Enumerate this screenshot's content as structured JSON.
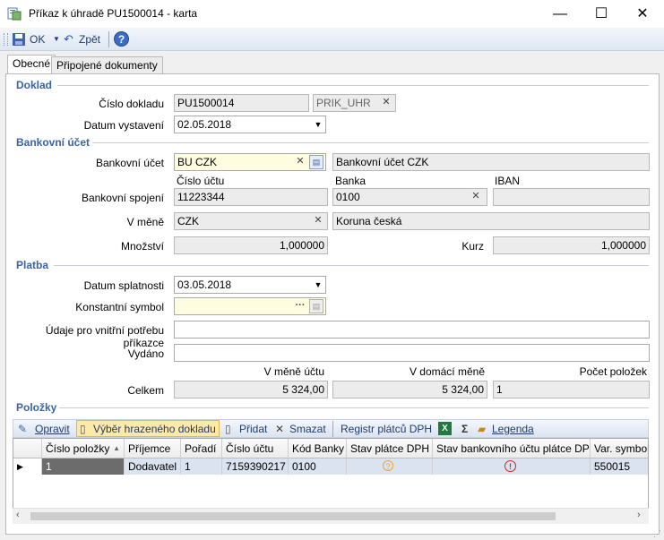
{
  "window": {
    "title": "Příkaz k úhradě PU1500014 - karta",
    "minimize": "—",
    "maximize": "☐",
    "close": "✕"
  },
  "toolbar": {
    "ok_label": "OK",
    "back_label": "Zpět",
    "help_label": "?"
  },
  "tabs": [
    {
      "label": "Obecné",
      "active": true
    },
    {
      "label": "Připojené dokumenty",
      "active": false
    }
  ],
  "doklad": {
    "section_title": "Doklad",
    "cislo_label": "Číslo dokladu",
    "cislo_value": "PU1500014",
    "rada_value": "PRIK_UHR",
    "datum_label": "Datum vystavení",
    "datum_value": "02.05.2018"
  },
  "bankovni_ucet": {
    "section_title": "Bankovní účet",
    "ucet_label": "Bankovní účet",
    "ucet_value": "BU CZK",
    "ucet_name": "Bankovní účet CZK",
    "col_cislo_uctu": "Číslo účtu",
    "col_banka": "Banka",
    "col_iban": "IBAN",
    "spojeni_label": "Bankovní spojení",
    "cislo_uctu_value": "11223344",
    "banka_value": "0100",
    "iban_value": "",
    "mena_label": "V měně",
    "mena_value": "CZK",
    "mena_name": "Koruna česká",
    "mnozstvi_label": "Množství",
    "mnozstvi_value": "1,000000",
    "kurz_label": "Kurz",
    "kurz_value": "1,000000"
  },
  "platba": {
    "section_title": "Platba",
    "splatnost_label": "Datum splatnosti",
    "splatnost_value": "03.05.2018",
    "ks_label": "Konstantní symbol",
    "ks_value": "",
    "udaje_label": "Údaje pro vnitřní potřebu příkazce",
    "udaje_value": "",
    "vydano_label": "Vydáno",
    "vydano_value": "",
    "col_mena_uctu": "V měně účtu",
    "col_domaci_mena": "V domácí měně",
    "col_pocet": "Počet položek",
    "celkem_label": "Celkem",
    "celkem_mena_uctu": "5 324,00",
    "celkem_domaci": "5 324,00",
    "pocet_polozek": "1"
  },
  "polozky": {
    "section_title": "Položky",
    "toolbar": {
      "opravit": "Opravit",
      "vyber": "Výběr hrazeného dokladu",
      "pridat": "Přidat",
      "smazat": "Smazat",
      "registr": "Registr plátců DPH",
      "sum": "Σ",
      "legenda": "Legenda"
    },
    "columns": [
      "Číslo položky",
      "Příjemce",
      "Pořadí",
      "Číslo účtu",
      "Kód Banky",
      "Stav plátce DPH",
      "Stav bankovního účtu plátce DPH",
      "Var. symbol"
    ],
    "rows": [
      {
        "cislo": "1",
        "prijemce": "Dodavatel",
        "poradi": "1",
        "cislo_uctu": "7159390217",
        "kod_banky": "0100",
        "stav_platce": "?",
        "stav_uctu": "!",
        "var_symbol": "550015"
      }
    ]
  },
  "colors": {
    "section_title": "#3a63a8",
    "selected_row": "#6c6c6c",
    "row_bg": "#dbe3f0",
    "warn_orange": "#e8a33d",
    "error_red": "#d9231d"
  }
}
